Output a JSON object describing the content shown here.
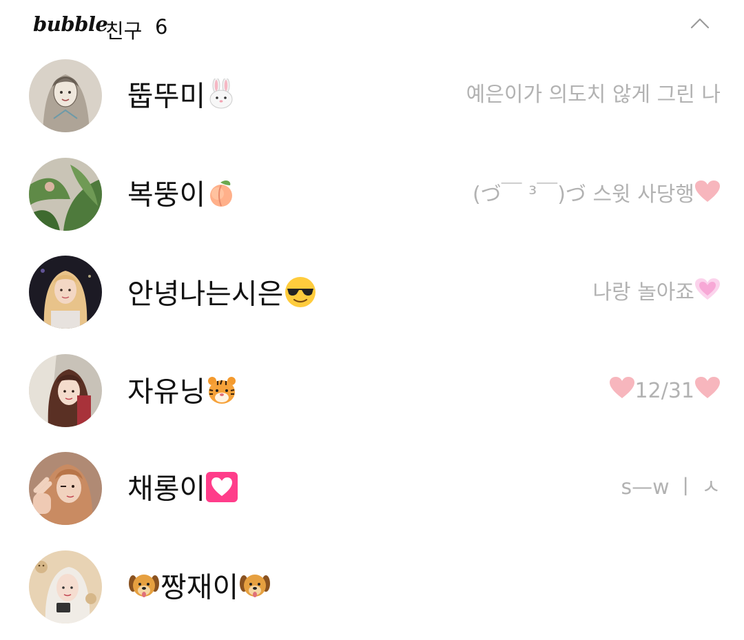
{
  "header": {
    "brand": "bubble",
    "section_title": "친구",
    "section_count": "6",
    "collapse_icon": "chevron-up-icon"
  },
  "friends": [
    {
      "name": "뚭뚜미",
      "name_emoji": "rabbit",
      "status": "예은이가 의도치 않게 그린 나",
      "status_emoji_left": "",
      "status_emoji_right": ""
    },
    {
      "name": "복뚱이",
      "name_emoji": "peach",
      "status": "(づ￣ ³￣)づ 스윗 사당행",
      "status_emoji_left": "",
      "status_emoji_right": "pink-heart"
    },
    {
      "name": "안녕나는시은",
      "name_emoji": "sunglasses-face",
      "status": "나랑 놀아죠",
      "status_emoji_left": "",
      "status_emoji_right": "glowing-heart"
    },
    {
      "name": "자유닝",
      "name_emoji": "tiger",
      "status": "12/31",
      "status_emoji_left": "pink-heart",
      "status_emoji_right": "pink-heart"
    },
    {
      "name": "채롱이",
      "name_emoji": "heart-box",
      "status": "s—w ㅣ ㅅ",
      "status_emoji_left": "",
      "status_emoji_right": ""
    },
    {
      "name": "짱재이",
      "name_emoji": "dog",
      "name_emoji_left": "dog",
      "status": "",
      "status_emoji_left": "",
      "status_emoji_right": ""
    }
  ],
  "colors": {
    "name_text": "#111111",
    "status_text": "#b2b2b2",
    "heart_pink": "#f7b6bd",
    "heart_box": "#ff3d8a"
  }
}
